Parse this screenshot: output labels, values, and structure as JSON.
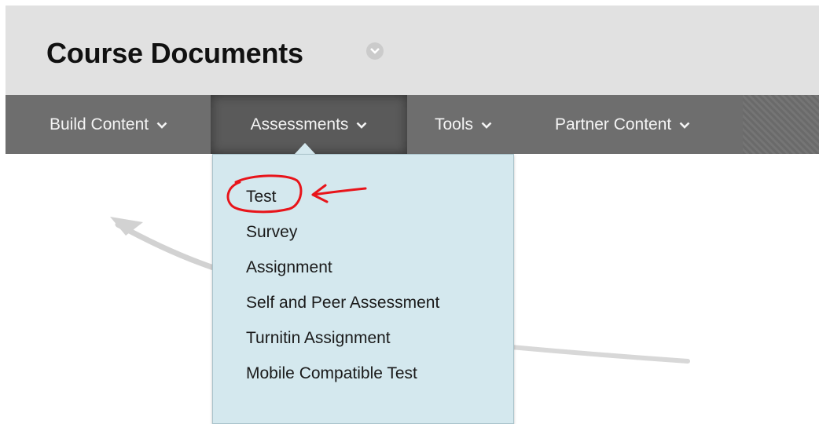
{
  "page": {
    "title": "Course Documents",
    "title_menu_icon": "chevron-down-icon"
  },
  "action_bar": {
    "items": [
      {
        "label": "Build Content",
        "icon": "chevron-down-icon"
      },
      {
        "label": "Assessments",
        "icon": "chevron-down-icon",
        "active": true
      },
      {
        "label": "Tools",
        "icon": "chevron-down-icon"
      },
      {
        "label": "Partner Content",
        "icon": "chevron-down-icon"
      }
    ]
  },
  "assessments_menu": {
    "items": [
      {
        "label": "Test",
        "highlighted": true
      },
      {
        "label": "Survey"
      },
      {
        "label": "Assignment"
      },
      {
        "label": "Self and Peer Assessment"
      },
      {
        "label": "Turnitin Assignment"
      },
      {
        "label": "Mobile Compatible Test"
      }
    ]
  },
  "colors": {
    "header_bg": "#e1e1e1",
    "action_bar_bg": "#6e6e6e",
    "dropdown_bg": "#d4e8ee",
    "annotation_red": "#e8141a"
  }
}
